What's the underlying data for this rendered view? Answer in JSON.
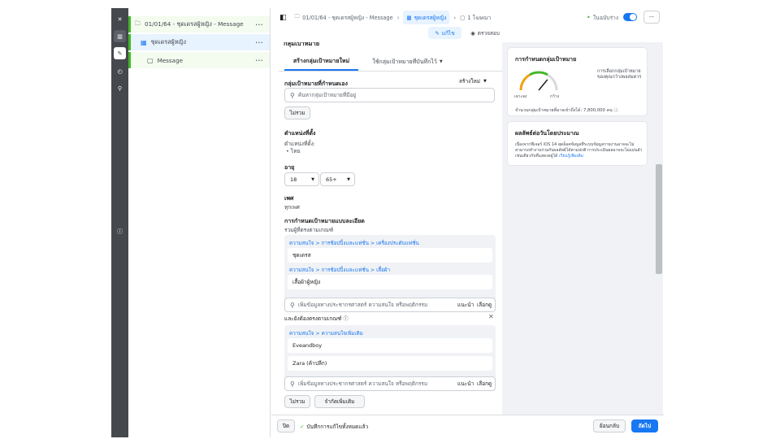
{
  "tree": {
    "campaign": "01/01/64 - ชุดเดรสผู้หญิง - Message",
    "adset": "ชุดเดรสผู้หญิง",
    "ad": "Message"
  },
  "topbar": {
    "crumb1": "01/01/64 - ชุดเดรสผู้หญิง - Message",
    "crumb2": "ชุดเดรสผู้หญิง",
    "crumb3": "1 โฆษณา",
    "status": "ในฉบับร่าง",
    "more": "···"
  },
  "editbar": {
    "edit": "แก้ไข",
    "review": "ตรวจสอบ"
  },
  "form": {
    "truncated_heading": "กลุ่มเป้าหมาย",
    "tab_new": "สร้างกลุ่มเป้าหมายใหม่",
    "tab_saved": "ใช้กลุ่มเป้าหมายที่บันทึกไว้",
    "custom_audience": "กลุ่มเป้าหมายที่กำหนดเอง",
    "create_new": "สร้างใหม่",
    "search_placeholder": "ค้นหากลุ่มเป้าหมายที่มีอยู่",
    "exclude": "ไม่รวม",
    "locations": "ตำแหน่งที่ตั้ง",
    "locations_sub": "ตำแหน่งที่ตั้ง:",
    "location_value": "ไทย",
    "age": "อายุ",
    "age_min": "18",
    "age_max": "65+",
    "gender": "เพศ",
    "gender_value": "ทุกเพศ",
    "detailed": "การกำหนดเป้าหมายแบบละเอียด",
    "include_match": "รวมผู้ที่ตรงตามเกณฑ์",
    "crumb_a": "ความสนใจ > การช้อปปิ้งและแฟชั่น > เครื่องประดับแฟชั่น",
    "item_a": "ชุดเดรส",
    "crumb_b": "ความสนใจ > การช้อปปิ้งและแฟชั่น > เสื้อผ้า",
    "item_b": "เสื้อผ้าผู้หญิง",
    "add_placeholder": "เพิ่มข้อมูลทางประชากรศาสตร์ ความสนใจ หรือพฤติกรรม",
    "suggest": "แนะนำ",
    "browse": "เลือกดู",
    "and_must": "และยังต้องตรงตามเกณฑ์",
    "crumb_c": "ความสนใจ > ความสนใจเพิ่มเติม",
    "item_c": "Eveandboy",
    "item_d": "Zara (ค้าปลีก)",
    "exclude2": "ไม่รวม",
    "narrow": "จำกัดเพิ่มเติม"
  },
  "side": {
    "card1_title": "การกำหนดกลุ่มเป้าหมาย",
    "card1_desc": "การเลือกกลุ่มเป้าหมายของคุณกว้างพอสมควร",
    "gauge_left": "เจาะจง",
    "gauge_right": "กว้าง",
    "reach": "จำนวนกลุ่มเป้าหมายที่อาจเข้าถึงได้: 7,800,000 คน",
    "gauge_level": 0.72,
    "card2_title": "ผลลัพธ์ต่อวันโดยประมาณ",
    "card2_desc": "เนื่องจากฟีเจอร์ iOS 14 สุดล็อคข้อมูลที่ระบบข้อมูลรายงานอาจจะไม่สามารถทำงานร่วมกับผลลัพธ์ได้ตามปกติ การประเมินผลอาจจะไม่แม่นยำเช่นเดียวกับที่แสดงอยู่ได้",
    "card2_link": "เรียนรู้เพิ่มเติม"
  },
  "footer": {
    "close": "ปิด",
    "saved": "บันทึกการแก้ไขทั้งหมดแล้ว",
    "back": "ย้อนกลับ",
    "next": "ถัดไป"
  },
  "colors": {
    "accent": "#1877f2",
    "rail": "#45484c",
    "green": "#42b72a"
  }
}
